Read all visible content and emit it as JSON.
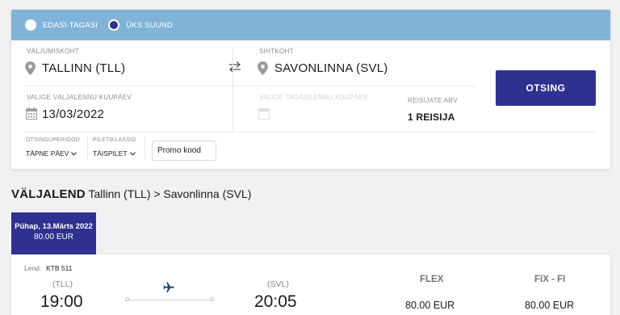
{
  "trip_type": {
    "options": [
      {
        "label": "EDASI-TAGASI",
        "selected": false
      },
      {
        "label": "ÜKS SUUND",
        "selected": true
      }
    ]
  },
  "origin": {
    "label": "VÄLJUMISKOHT",
    "value": "TALLINN (TLL)"
  },
  "destination": {
    "label": "SIHTKOHT",
    "value": "SAVONLINNA (SVL)"
  },
  "departure_date": {
    "label": "VALIGE VÄLJALENNU KUUPÄEV",
    "value": "13/03/2022"
  },
  "return_date": {
    "label": "VALIGE TAGASILENNU KUUPÄEV"
  },
  "passengers": {
    "label": "REISIJATE ARV",
    "value": "1 REISIJA"
  },
  "search_button": "OTSING",
  "search_period": {
    "label": "OTSINGUPERIOOD",
    "value": "TÄPNE PÄEV"
  },
  "fare_class": {
    "label": "PILETIKLASSID",
    "value": "TÄISPILET"
  },
  "promo": {
    "placeholder": "Promo kood"
  },
  "route": {
    "title_bold": "VÄLJALEND",
    "title_rest": " Tallinn (TLL) > Savonlinna (SVL)"
  },
  "date_tab": {
    "date": "Pühap, 13.Märts 2022",
    "price": "80.00 EUR"
  },
  "flight": {
    "flight_label": "Lend:",
    "flight_number": "KTB 511",
    "origin_code": "(TLL)",
    "departure_time": "19:00",
    "destination_code": "(SVL)",
    "arrival_time": "20:05",
    "fares": [
      {
        "name": "FLEX",
        "price": "80.00 EUR"
      },
      {
        "name": "FIX - FI",
        "price": "80.00 EUR"
      }
    ]
  },
  "colors": {
    "brand": "#2e3190",
    "trip_bar": "#7fb3d8"
  }
}
